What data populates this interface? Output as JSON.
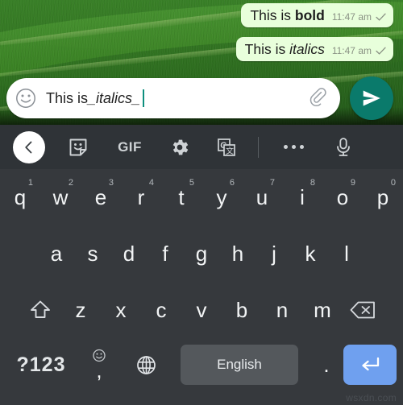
{
  "chat": {
    "messages": [
      {
        "text_plain": "This is ",
        "text_styled": "bold",
        "style": "bold",
        "time": "11:47 am",
        "status": "sent-single-check"
      },
      {
        "text_plain": "This is ",
        "text_styled": "italics",
        "style": "italic",
        "time": "11:47 am",
        "status": "sent-single-check"
      }
    ]
  },
  "input": {
    "value_plain": "This is ",
    "value_markup": "_italics_",
    "emoji_icon": "smiley-icon",
    "attach_icon": "paperclip-icon",
    "send_icon": "send-plane-icon"
  },
  "toolbar": {
    "back_label": "‹",
    "sticker_label": "sticker-icon",
    "gif_label": "GIF",
    "settings_label": "gear-icon",
    "translate_label": "G",
    "more_label": "overflow-dots",
    "mic_label": "microphone-icon"
  },
  "keyboard": {
    "row1": [
      {
        "key": "q",
        "sup": "1"
      },
      {
        "key": "w",
        "sup": "2"
      },
      {
        "key": "e",
        "sup": "3"
      },
      {
        "key": "r",
        "sup": "4"
      },
      {
        "key": "t",
        "sup": "5"
      },
      {
        "key": "y",
        "sup": "6"
      },
      {
        "key": "u",
        "sup": "7"
      },
      {
        "key": "i",
        "sup": "8"
      },
      {
        "key": "o",
        "sup": "9"
      },
      {
        "key": "p",
        "sup": "0"
      }
    ],
    "row2": [
      {
        "key": "a"
      },
      {
        "key": "s"
      },
      {
        "key": "d"
      },
      {
        "key": "f"
      },
      {
        "key": "g"
      },
      {
        "key": "h"
      },
      {
        "key": "j"
      },
      {
        "key": "k"
      },
      {
        "key": "l"
      }
    ],
    "row3": [
      {
        "key": "shift-icon"
      },
      {
        "key": "z"
      },
      {
        "key": "x"
      },
      {
        "key": "c"
      },
      {
        "key": "v"
      },
      {
        "key": "b"
      },
      {
        "key": "n"
      },
      {
        "key": "m"
      },
      {
        "key": "backspace-icon"
      }
    ],
    "row4": {
      "symbols_label": "?123",
      "comma_label": ",",
      "emoji_label": "emoji-icon",
      "globe_label": "globe-icon",
      "space_label": "English",
      "period_label": ".",
      "enter_label": "enter-icon"
    }
  },
  "watermark": "wsxdn.com",
  "colors": {
    "bubble": "#e8ffdb",
    "send_button": "#0a7a6b",
    "keyboard_bg": "#36393d",
    "toolbar_bg": "#2f3337",
    "spacebar": "#54585c",
    "enter_key": "#6fa0ef",
    "caret": "#0e8f7e"
  }
}
